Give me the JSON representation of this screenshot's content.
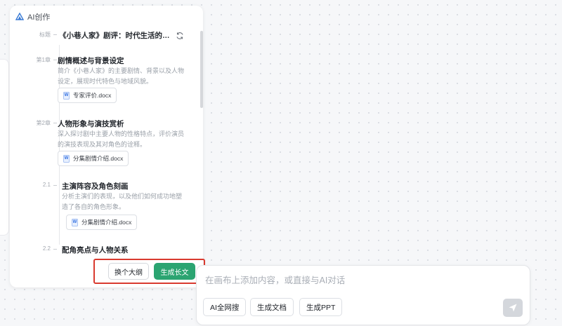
{
  "panel": {
    "title": "AI创作",
    "outline_title_label": "标题",
    "outline_title": "《小巷人家》剧评：时代生活的…",
    "sections": [
      {
        "label": "第1章",
        "heading": "剧情概述与背景设定",
        "desc": "简介《小巷人家》的主要剧情、背景以及人物设定，展现时代特色与地域风貌。",
        "file": "专家评价.docx"
      },
      {
        "label": "第2章",
        "heading": "人物形象与演技赏析",
        "desc": "深入探讨剧中主要人物的性格特点，评价演员的演技表现及其对角色的诠释。",
        "file": "分集剧情介绍.docx"
      },
      {
        "label": "2.1",
        "heading": "主演阵容及角色刻画",
        "desc": "分析主演们的表现，以及他们如何成功地塑造了各自的角色形象。",
        "file": "分集剧情介绍.docx"
      },
      {
        "label": "2.2",
        "heading": "配角亮点与人物关系",
        "desc": "",
        "file": ""
      }
    ],
    "buttons": {
      "change_outline": "换个大纲",
      "generate_long": "生成长文"
    }
  },
  "chat": {
    "placeholder": "在画布上添加内容，或直接与AI对话",
    "actions": [
      "AI全网搜",
      "生成文档",
      "生成PPT"
    ]
  },
  "colors": {
    "accent_green": "#2ba471",
    "highlight_red": "#d93a2f"
  }
}
